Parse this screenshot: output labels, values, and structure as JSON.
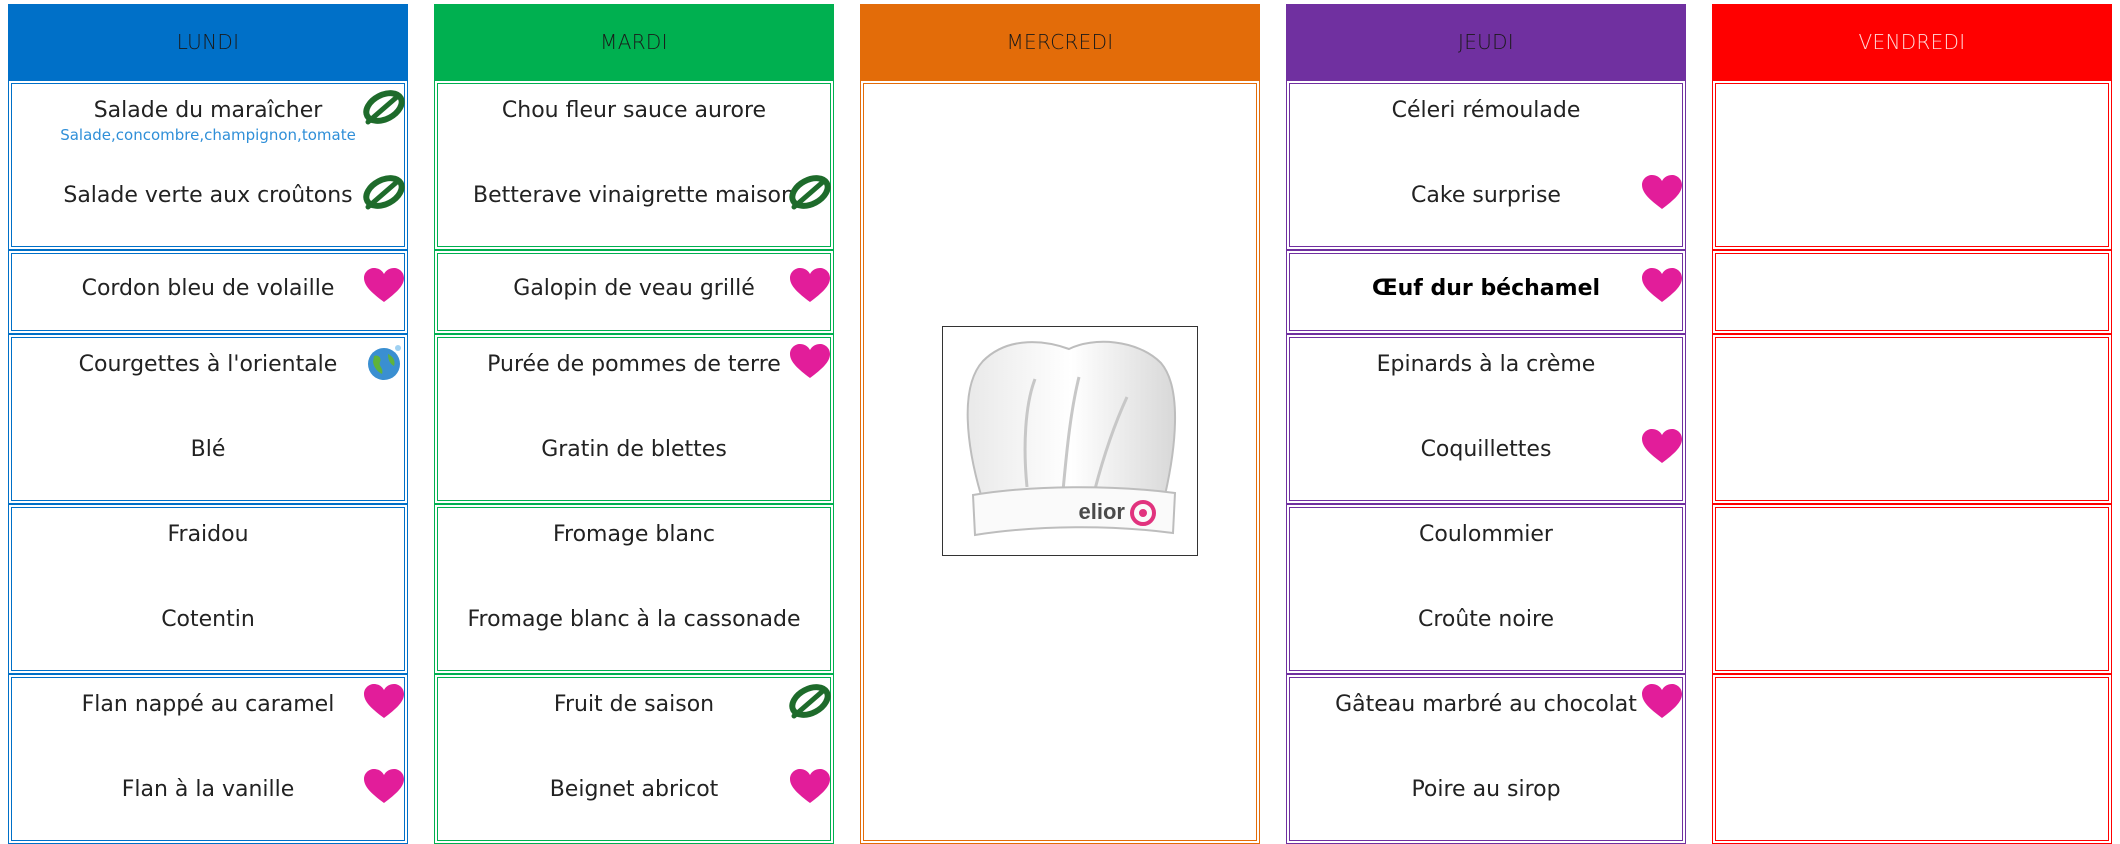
{
  "colors": {
    "lundi": "#0070c8",
    "mardi": "#00b050",
    "mercredi": "#e36c09",
    "jeudi": "#7030a0",
    "vendredi": "#ff0000",
    "heart": "#e21d9a",
    "leaf": "#1e6b2b"
  },
  "days": [
    {
      "name": "LUNDI",
      "sections": [
        [
          {
            "text": "Salade du maraîcher",
            "sub": "Salade,concombre,champignon,tomate",
            "icon": "leaf-icon"
          },
          {
            "text": "Salade verte aux croûtons",
            "icon": "leaf-icon"
          }
        ],
        [
          {
            "text": "Cordon bleu de volaille",
            "icon": "heart-icon"
          }
        ],
        [
          {
            "text": "Courgettes à l'orientale",
            "icon": "globe-icon"
          },
          {
            "text": "Blé"
          }
        ],
        [
          {
            "text": "Fraidou"
          },
          {
            "text": "Cotentin"
          }
        ],
        [
          {
            "text": "Flan nappé au caramel",
            "icon": "heart-icon"
          },
          {
            "text": "Flan à la vanille",
            "icon": "heart-icon"
          }
        ]
      ]
    },
    {
      "name": "MARDI",
      "sections": [
        [
          {
            "text": "Chou fleur sauce aurore"
          },
          {
            "text": "Betterave vinaigrette maison",
            "icon": "leaf-icon"
          }
        ],
        [
          {
            "text": "Galopin de veau grillé",
            "icon": "heart-icon"
          }
        ],
        [
          {
            "text": "Purée de pommes de terre",
            "icon": "heart-icon"
          },
          {
            "text": "Gratin de blettes"
          }
        ],
        [
          {
            "text": "Fromage blanc"
          },
          {
            "text": "Fromage blanc à la cassonade"
          }
        ],
        [
          {
            "text": "Fruit de saison",
            "icon": "leaf-icon"
          },
          {
            "text": "Beignet abricot",
            "icon": "heart-icon"
          }
        ]
      ]
    },
    {
      "name": "MERCREDI",
      "logo_text": "elior"
    },
    {
      "name": "JEUDI",
      "sections": [
        [
          {
            "text": "Céleri rémoulade"
          },
          {
            "text": "Cake surprise",
            "icon": "heart-icon"
          }
        ],
        [
          {
            "text": "Œuf dur béchamel",
            "icon": "heart-icon",
            "bold": true
          }
        ],
        [
          {
            "text": "Epinards à la crème"
          },
          {
            "text": "Coquillettes",
            "icon": "heart-icon"
          }
        ],
        [
          {
            "text": "Coulommier"
          },
          {
            "text": "Croûte noire"
          }
        ],
        [
          {
            "text": "Gâteau marbré au chocolat",
            "icon": "heart-icon"
          },
          {
            "text": "Poire au sirop"
          }
        ]
      ]
    },
    {
      "name": "VENDREDI",
      "sections": [
        [],
        [],
        [],
        [],
        []
      ]
    }
  ]
}
